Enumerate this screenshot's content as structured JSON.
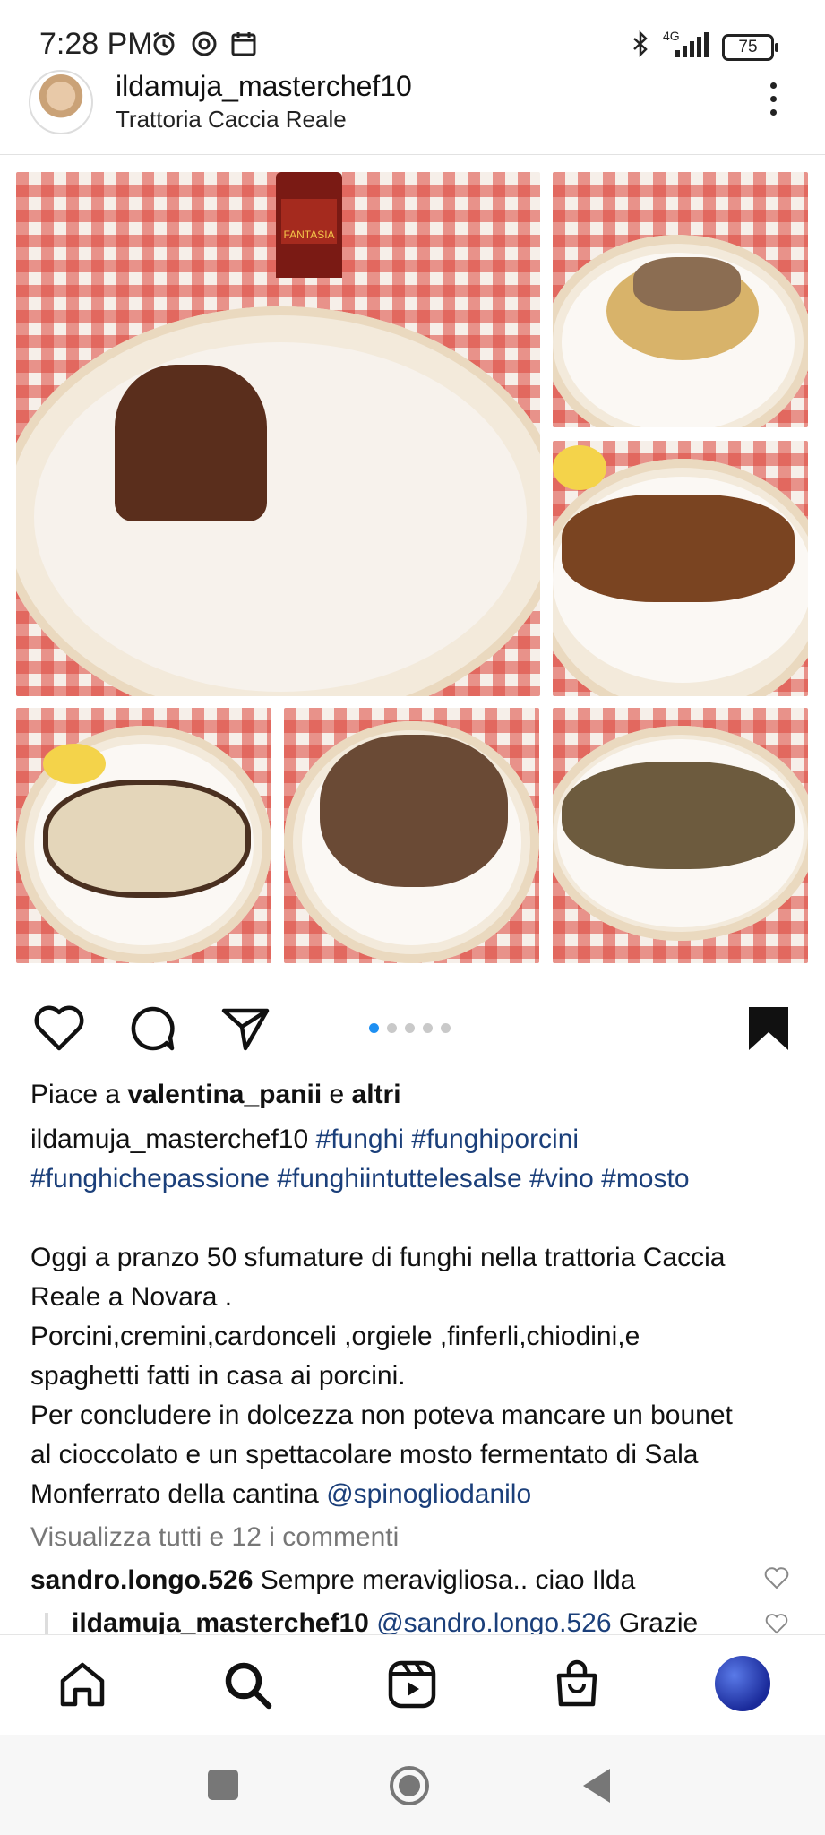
{
  "status_bar": {
    "time": "7:28 PM",
    "network": "4G",
    "battery": "75"
  },
  "post": {
    "username": "ildamuja_masterchef10",
    "location": "Trattoria Caccia Reale",
    "likes": {
      "prefix": "Piace a",
      "user": "valentina_panii",
      "conj": "e",
      "others": "altri"
    },
    "caption_user": "ildamuja_masterchef10",
    "hashtags_line1": "#funghi #funghiporcini",
    "hashtags_line2": "#funghichepassione #funghiintuttelesalse #vino #mosto",
    "caption_lines": [
      "Oggi a pranzo 50  sfumature di funghi nella trattoria Caccia",
      "Reale a Novara .",
      "Porcini,cremini,cardonceli ,orgiele ,finferli,chiodini,e",
      "spaghetti fatti in casa ai porcini.",
      "Per concludere in dolcezza non poteva mancare un bounet",
      "al cioccolato e un spettacolare mosto fermentato di Sala",
      "Monferrato della cantina"
    ],
    "mention": "@spinogliodanilo",
    "view_comments": "Visualizza tutti e 12 i commenti",
    "comments": [
      {
        "user": "sandro.longo.526",
        "text": "Sempre meravigliosa.. ciao Ilda"
      },
      {
        "user": "ildamuja_masterchef10",
        "mention": "@sandro.longo.526",
        "text": "Grazie"
      }
    ],
    "wine_label": "FANTASIA"
  },
  "carousel": {
    "count": 5,
    "active": 0
  },
  "colors": {
    "accent": "#1d8ff2",
    "hashtag": "#1b3f7a",
    "tablecloth": "#dc463c"
  },
  "icons": [
    "like-icon",
    "comment-icon",
    "share-icon",
    "save-icon",
    "home-icon",
    "search-icon",
    "reels-icon",
    "shop-icon",
    "profile-icon"
  ]
}
